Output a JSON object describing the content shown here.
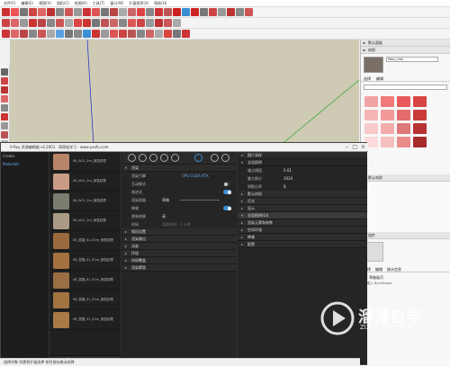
{
  "menubar": {
    "items": [
      "文件(F)",
      "编辑(E)",
      "视图(V)",
      "相机(C)",
      "绘图(R)",
      "工具(T)",
      "窗口(W)",
      "扩展程序(X)",
      "帮助(H)"
    ]
  },
  "vray": {
    "title": "V-Ray 资源编辑器 v4.2001 · 萌萌哒学习 · www.yxxfu.com",
    "tree": {
      "items": [
        "Create",
        "Materials"
      ]
    },
    "materials": [
      "08_AO1_1m_渐显纹理",
      "08_AO1_1m_渐显纹理",
      "08_AO1_1m_渐显纹理",
      "08_AO1_1m_渐显纹理",
      "08_混凝_01_01m_渐显纹理",
      "08_混凝_01_01m_渐显纹理",
      "08_混凝_01_01m_渐显纹理",
      "08_混凝_01_01m_渐显纹理",
      "08_混凝_01_01m_渐显纹理"
    ],
    "settings": {
      "render_section": "渲染",
      "rows": [
        {
          "label": "渲染引擎",
          "value": "CPU  CUDA  RTX"
        },
        {
          "label": "互动模式",
          "value": ""
        },
        {
          "label": "渐进式",
          "value": ""
        },
        {
          "label": "渲染质量",
          "value": "草稿"
        },
        {
          "label": "降噪",
          "value": ""
        },
        {
          "label": "更新效果",
          "value": "高"
        },
        {
          "label": "时间",
          "value": "渲染时间 · 1 小时"
        }
      ],
      "sections": [
        "相机设置",
        "渲染输出",
        "动画",
        "环境",
        "材质覆盖",
        "渲染蒙版"
      ]
    },
    "advanced": {
      "sections": [
        "图片采样",
        "全局照明",
        "默认材质",
        "灯光",
        "显示",
        "全局照明(GI)",
        "渲染元素和参数",
        "空间环境",
        "降噪",
        "配置"
      ],
      "sample_row": {
        "label": "噪点阈值",
        "value": "0.01"
      },
      "sample_row2": {
        "label": "最大细分",
        "value": "1024"
      },
      "light_row": {
        "label": "阴影比率",
        "value": "8"
      }
    }
  },
  "rightpanel": {
    "default_tray": "默认面板",
    "material_label": "材质",
    "material_name": "Maro_Hak",
    "tabs": [
      "选择",
      "编辑"
    ],
    "swatches": [
      "#f2a3a3",
      "#f07a7a",
      "#e85a5a",
      "#d94545",
      "#f6b6b6",
      "#f29a9a",
      "#e36b6b",
      "#c93b3b",
      "#f8c9c9",
      "#f4adad",
      "#df7878",
      "#b83333",
      "#fbdada",
      "#f6bfbf",
      "#e88c8c",
      "#a62b2b"
    ],
    "section2": "默认材质",
    "section3": "组件",
    "component_tabs": [
      "选择",
      "编辑",
      "统计信息"
    ],
    "component_text": "1F 草抽板灯",
    "component_sub": "在插入 DynAScape",
    "colors": {
      "accent": "#3b8fd6",
      "panel_bg": "#202020"
    }
  },
  "watermark": {
    "brand": "溜溜自学",
    "url": "ZIXUE.3D66.COM"
  },
  "statusbar": {
    "text": "选择对象  切换到扩展选择  按住鼠标拖动选择"
  }
}
